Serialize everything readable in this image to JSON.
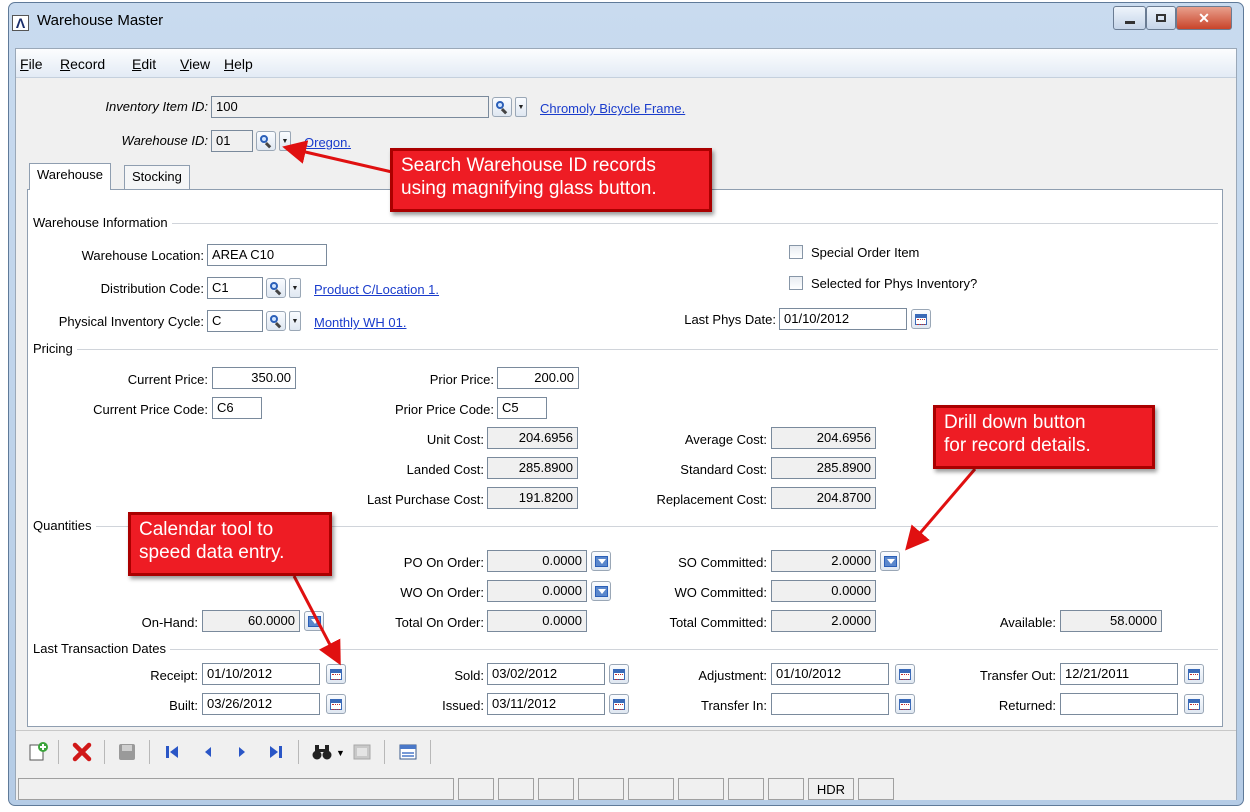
{
  "window": {
    "title": "Warehouse Master",
    "logo": "Λ"
  },
  "menu": [
    {
      "key": "F",
      "rest": "ile"
    },
    {
      "key": "R",
      "rest": "ecord"
    },
    {
      "key": "E",
      "rest": "dit"
    },
    {
      "key": "V",
      "rest": "iew"
    },
    {
      "key": "H",
      "rest": "elp"
    }
  ],
  "header": {
    "item_label": "Inventory Item ID:",
    "item_value": "100",
    "item_link": "Chromoly Bicycle Frame.",
    "wh_label": "Warehouse ID:",
    "wh_value": "01",
    "wh_link": "Oregon."
  },
  "tabs": [
    "Warehouse",
    "Stocking"
  ],
  "warehouse_info": {
    "section": "Warehouse Information",
    "location_label": "Warehouse Location:",
    "location_value": "AREA C10",
    "dist_label": "Distribution Code:",
    "dist_value": "C1",
    "dist_link": "Product C/Location 1.",
    "cycle_label": "Physical Inventory Cycle:",
    "cycle_value": "C",
    "cycle_link": "Monthly WH 01.",
    "special_order_label": "Special Order Item",
    "phys_inv_label": "Selected for Phys Inventory?",
    "last_phys_label": "Last Phys Date:",
    "last_phys_value": "01/10/2012"
  },
  "pricing": {
    "section": "Pricing",
    "current_price_label": "Current Price:",
    "current_price": "350.00",
    "current_code_label": "Current Price Code:",
    "current_code": "C6",
    "prior_price_label": "Prior Price:",
    "prior_price": "200.00",
    "prior_code_label": "Prior Price Code:",
    "prior_code": "C5",
    "unit_cost_label": "Unit Cost:",
    "unit_cost": "204.6956",
    "landed_cost_label": "Landed Cost:",
    "landed_cost": "285.8900",
    "last_purchase_label": "Last Purchase Cost:",
    "last_purchase": "191.8200",
    "avg_cost_label": "Average Cost:",
    "avg_cost": "204.6956",
    "std_cost_label": "Standard Cost:",
    "std_cost": "285.8900",
    "repl_cost_label": "Replacement Cost:",
    "repl_cost": "204.8700"
  },
  "quantities": {
    "section": "Quantities",
    "onhand_label": "On-Hand:",
    "onhand": "60.0000",
    "po_label": "PO On Order:",
    "po": "0.0000",
    "wo_label": "WO On Order:",
    "wo": "0.0000",
    "total_order_label": "Total On Order:",
    "total_order": "0.0000",
    "so_comm_label": "SO Committed:",
    "so_comm": "2.0000",
    "wo_comm_label": "WO Committed:",
    "wo_comm": "0.0000",
    "total_comm_label": "Total Committed:",
    "total_comm": "2.0000",
    "available_label": "Available:",
    "available": "58.0000"
  },
  "dates": {
    "section": "Last Transaction Dates",
    "receipt_label": "Receipt:",
    "receipt": "01/10/2012",
    "built_label": "Built:",
    "built": "03/26/2012",
    "sold_label": "Sold:",
    "sold": "03/02/2012",
    "issued_label": "Issued:",
    "issued": "03/11/2012",
    "adjustment_label": "Adjustment:",
    "adjustment": "01/10/2012",
    "transfer_in_label": "Transfer In:",
    "transfer_in": "",
    "transfer_out_label": "Transfer Out:",
    "transfer_out": "12/21/2011",
    "returned_label": "Returned:",
    "returned": ""
  },
  "callouts": {
    "search": [
      "Search Warehouse ID records",
      "using magnifying glass button."
    ],
    "drill": [
      "Drill down button",
      "for record details."
    ],
    "calendar": [
      "Calendar tool to",
      "speed data entry."
    ]
  },
  "status": {
    "hdr": "HDR"
  },
  "colors": {
    "callout": "#ee1c24",
    "link": "#1a3ccc",
    "close_btn": "#c9442a"
  }
}
